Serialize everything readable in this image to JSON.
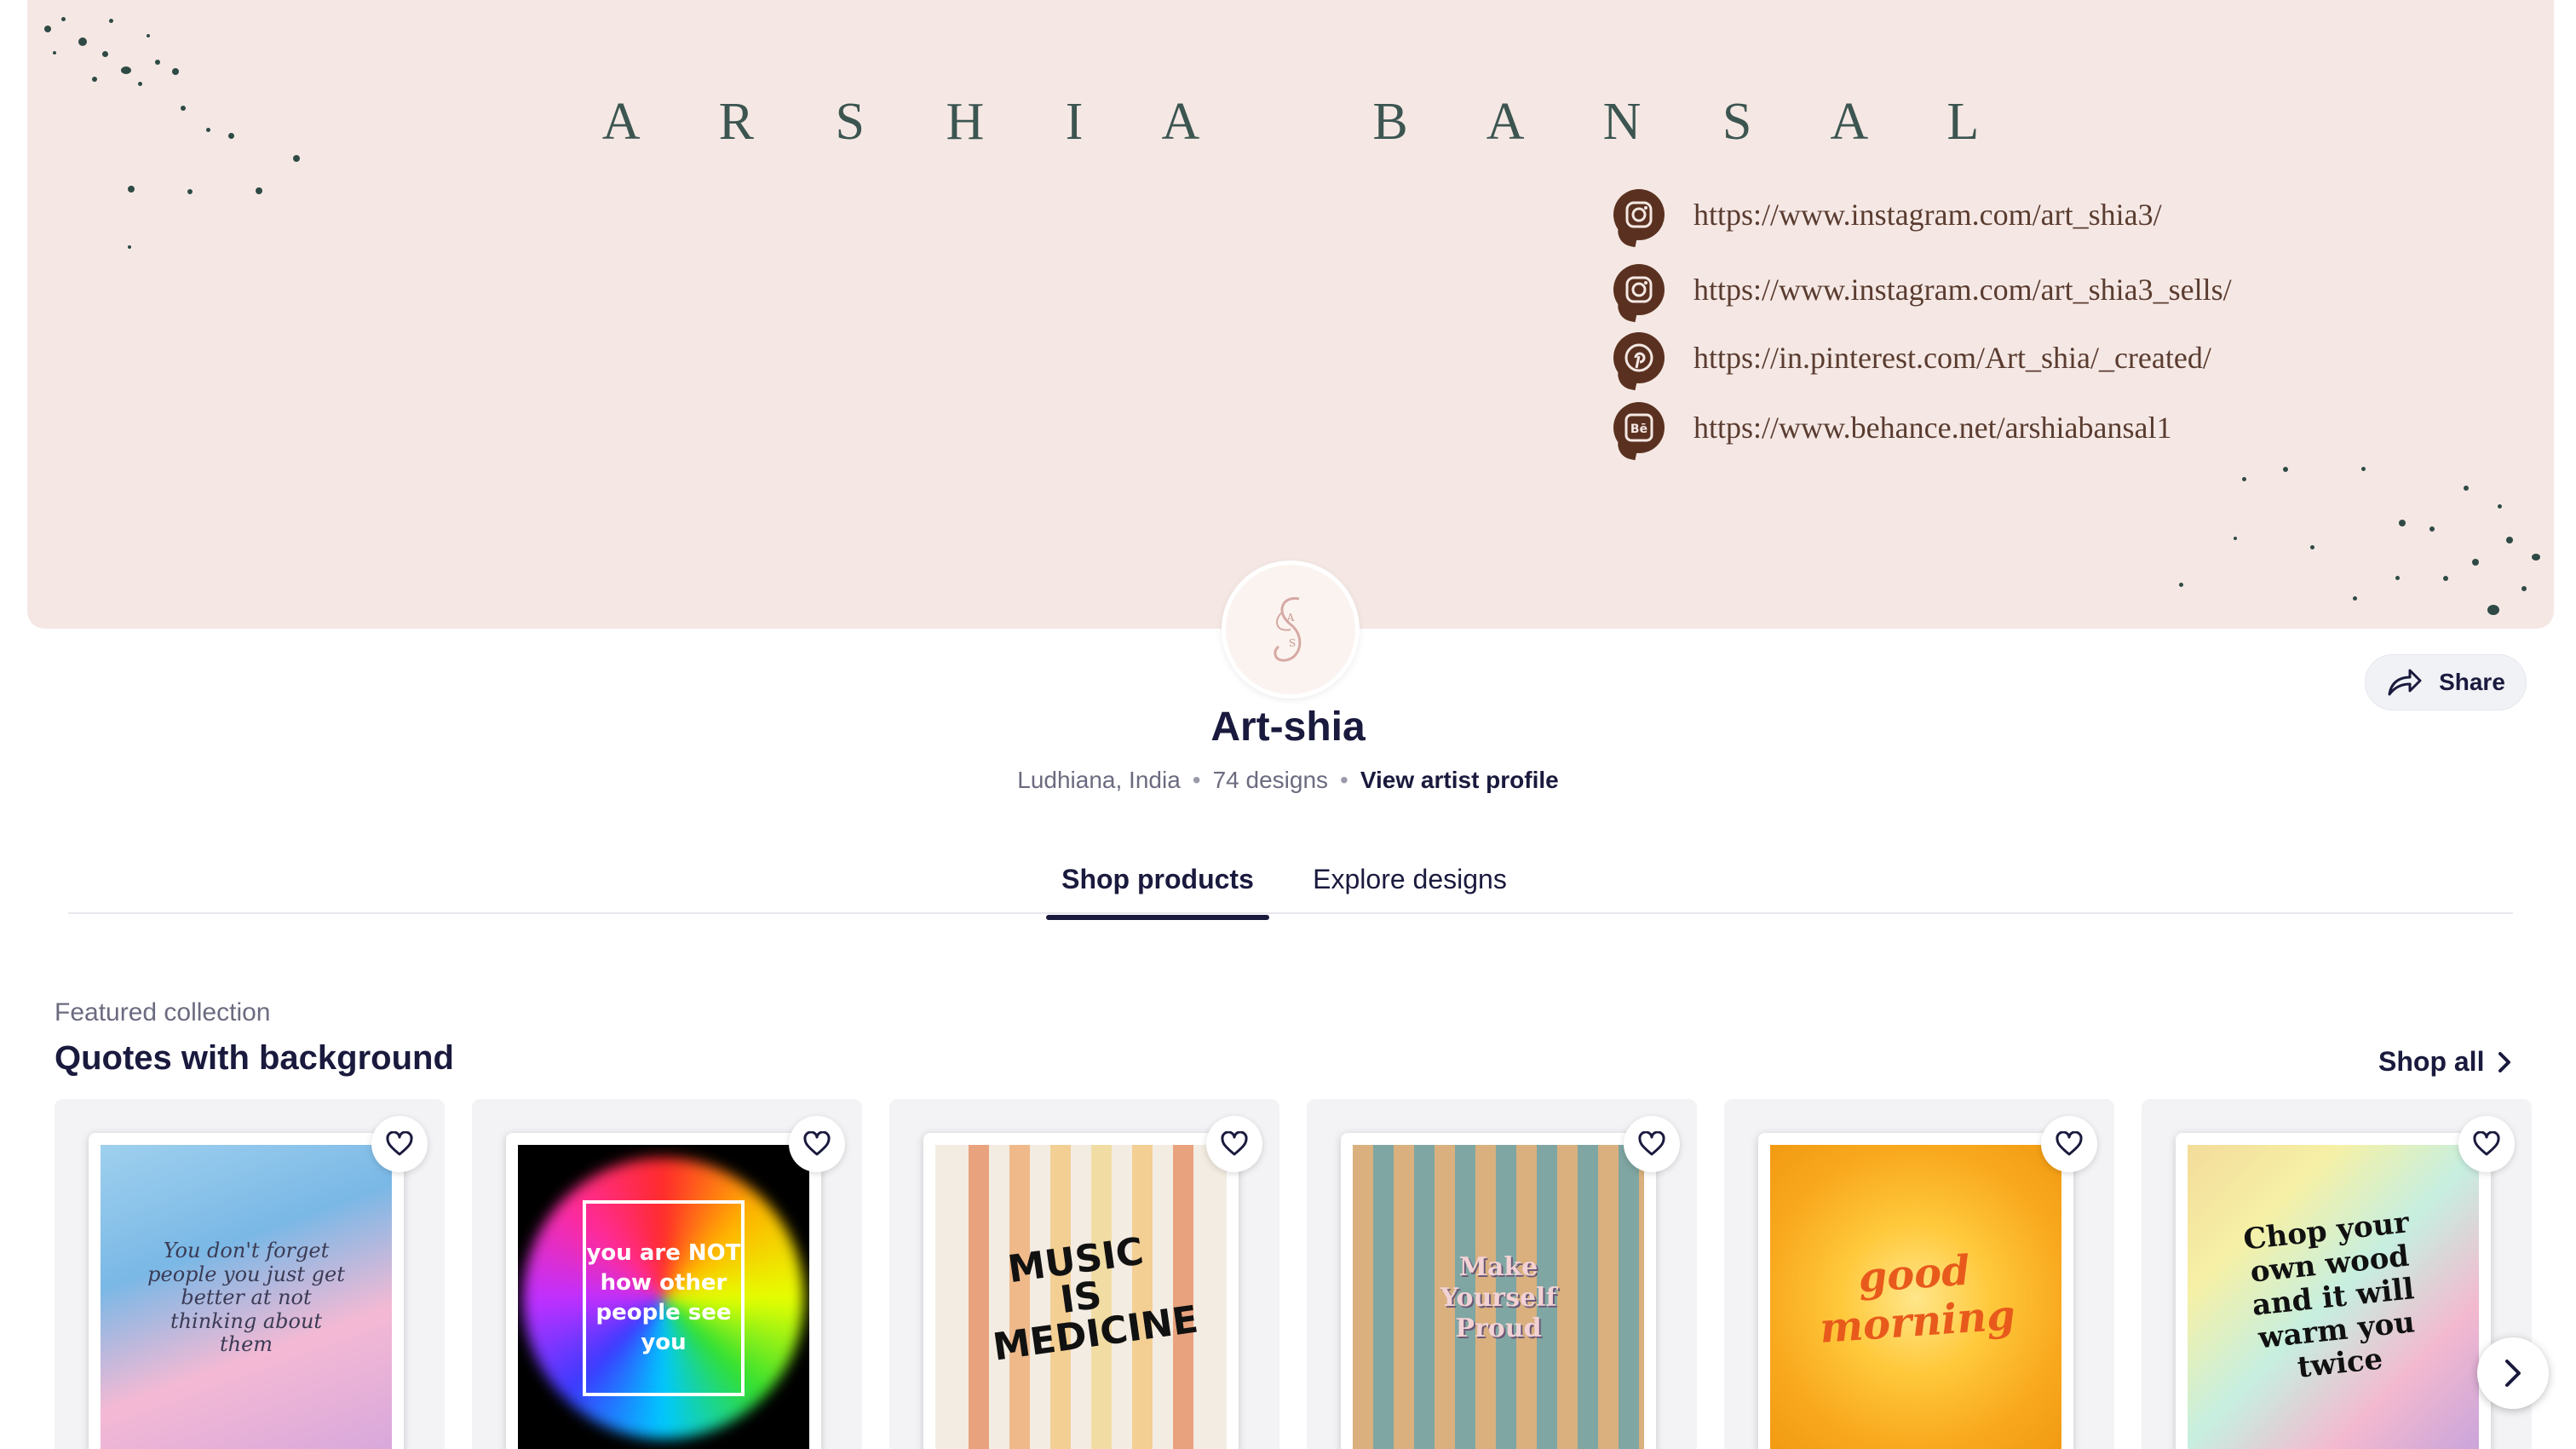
{
  "banner": {
    "title": "A R S H I A   B A N S A L",
    "links": [
      {
        "icon": "instagram-icon",
        "url": "https://www.instagram.com/art_shia3/"
      },
      {
        "icon": "instagram-icon",
        "url": "https://www.instagram.com/art_shia3_sells/"
      },
      {
        "icon": "pinterest-icon",
        "url": "https://in.pinterest.com/Art_shia/_created/"
      },
      {
        "icon": "behance-icon",
        "url": "https://www.behance.net/arshiabansal1"
      }
    ]
  },
  "share": {
    "label": "Share"
  },
  "artist": {
    "name": "Art-shia",
    "location": "Ludhiana, India",
    "designs": "74 designs",
    "profile_link": "View artist profile"
  },
  "tabs": [
    {
      "label": "Shop products",
      "active": true
    },
    {
      "label": "Explore designs",
      "active": false
    }
  ],
  "collection": {
    "kicker": "Featured collection",
    "title": "Quotes with background",
    "shop_all": "Shop all",
    "items": [
      {
        "art_text": "You don't forget people you just get better at not thinking about them"
      },
      {
        "art_text": "you are NOT how other people see you"
      },
      {
        "art_text": "MUSIC IS MEDICINE"
      },
      {
        "art_text": "Make Yourself Proud"
      },
      {
        "art_text": "good morning"
      },
      {
        "art_text": "Chop your own wood and it will warm you twice"
      }
    ]
  },
  "colors": {
    "banner_bg": "#f5e8e4",
    "text_primary": "#1a1a3e",
    "social_brown": "#5a3120"
  }
}
